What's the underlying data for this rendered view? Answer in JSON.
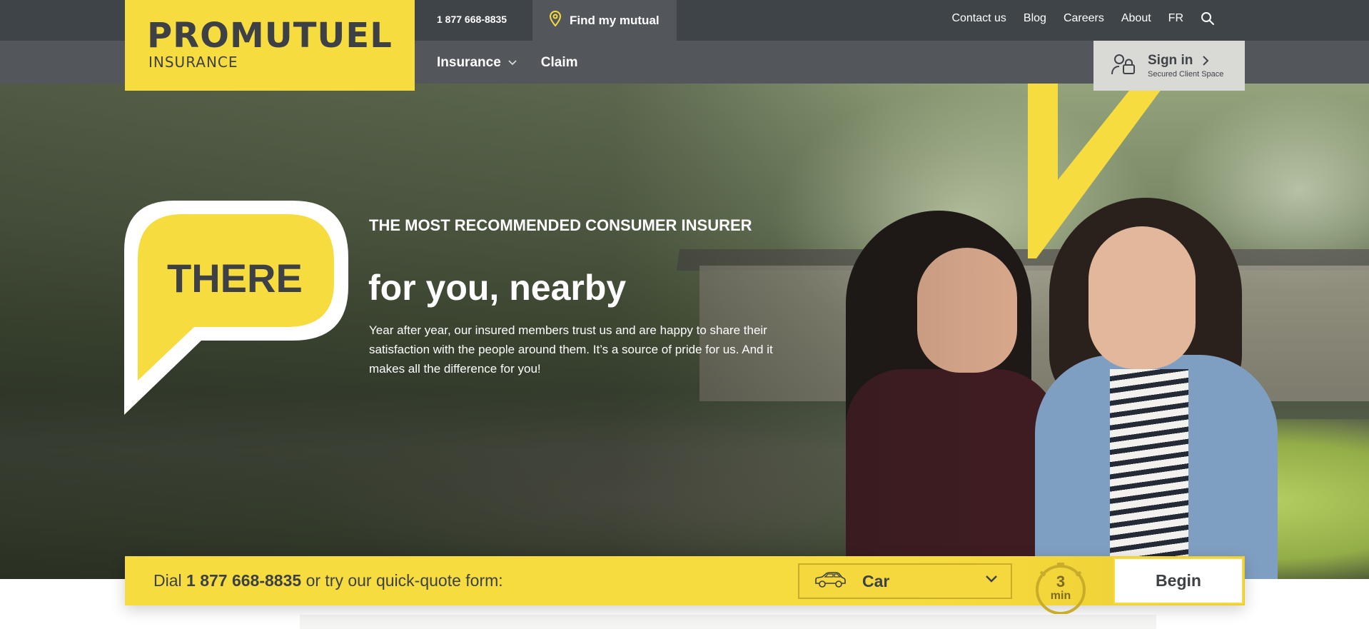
{
  "brand": {
    "name": "PROMUTUEL",
    "subtitle": "INSURANCE"
  },
  "topbar": {
    "phone": "1 877 668-8835",
    "find_mutual": "Find my mutual",
    "links": [
      "Contact us",
      "Blog",
      "Careers",
      "About",
      "FR"
    ],
    "search_icon": "search-icon"
  },
  "nav": {
    "insurance": "Insurance",
    "claim": "Claim"
  },
  "signin": {
    "label": "Sign in",
    "sublabel": "Secured Client Space",
    "icon": "lock-user-icon"
  },
  "hero": {
    "bubble_word": "THERE",
    "eyebrow": "THE MOST RECOMMENDED CONSUMER INSURER",
    "title": "for you, nearby",
    "text": "Year after year, our insured members trust us and are happy to share their satisfaction with the people around them. It’s a source of pride for us. And it makes all the difference for you!"
  },
  "quote": {
    "prefix": "Dial",
    "phone": "1 877 668-8835",
    "suffix": "or try our quick-quote form:",
    "selected": "Car",
    "timer_value": "3",
    "timer_unit": "min",
    "begin": "Begin"
  },
  "colors": {
    "brand_yellow": "#f7dc3f",
    "dark_gray": "#3f4448",
    "nav_gray": "#53575b"
  }
}
